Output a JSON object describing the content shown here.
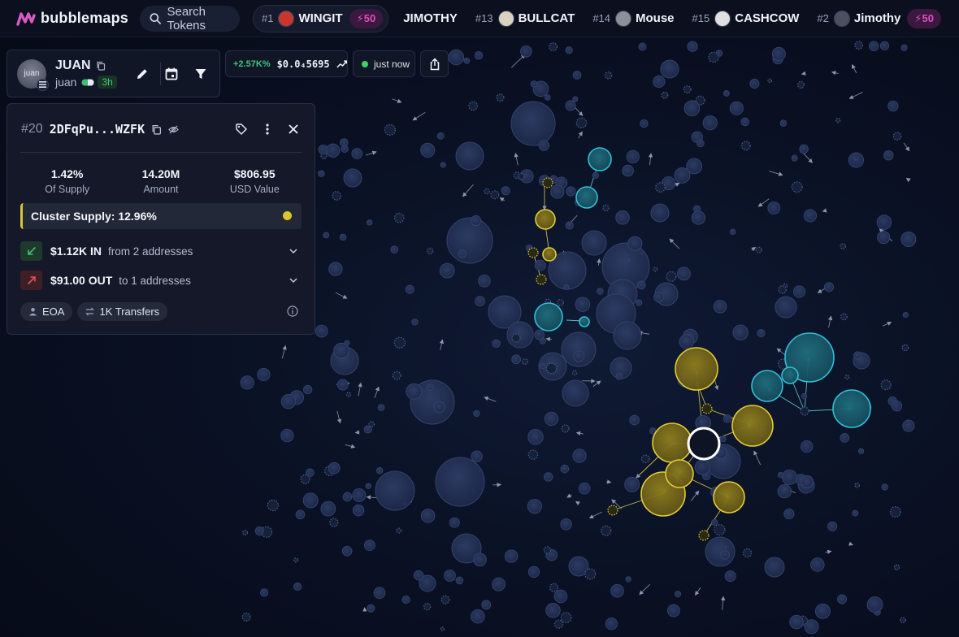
{
  "app": {
    "name": "bubblemaps"
  },
  "search": {
    "placeholder": "Search Tokens"
  },
  "trending": [
    {
      "rank": "#1",
      "name": "WINGIT",
      "boost": "50",
      "avatar_color": "#c8362f"
    },
    {
      "rank": "",
      "name": "JIMOTHY",
      "boost": "",
      "avatar_color": ""
    },
    {
      "rank": "#13",
      "name": "BULLCAT",
      "boost": "",
      "avatar_color": "#d9d2c0"
    },
    {
      "rank": "#14",
      "name": "Mouse",
      "boost": "",
      "avatar_color": "#8a8f9a"
    },
    {
      "rank": "#15",
      "name": "CASHCOW",
      "boost": "",
      "avatar_color": "#e0e0e0"
    },
    {
      "rank": "#2",
      "name": "Jimothy",
      "boost": "50",
      "avatar_color": "#4b5060"
    }
  ],
  "wallet": {
    "name": "JUAN",
    "handle": "juan",
    "age": "3h",
    "avatar_text": "juan"
  },
  "price": {
    "change": "+2.57K%",
    "value": "$0.0₄5695"
  },
  "live": {
    "label": "just now"
  },
  "panel": {
    "rank": "#20",
    "address": "2DFqPu...WZFK",
    "stats": [
      {
        "value": "1.42%",
        "label": "Of Supply"
      },
      {
        "value": "14.20M",
        "label": "Amount"
      },
      {
        "value": "$806.95",
        "label": "USD Value"
      }
    ],
    "cluster_supply": "Cluster Supply: 12.96%",
    "inflow": {
      "amount": "$1.12K IN",
      "desc": "from 2 addresses"
    },
    "outflow": {
      "amount": "$91.00 OUT",
      "desc": "to 1 addresses"
    },
    "tags": {
      "type": "EOA",
      "transfers": "1K Transfers"
    }
  },
  "colors": {
    "accent_pink": "#e04fbd",
    "cluster_yellow": "#dcc52c",
    "cluster_cyan": "#2fb4c8",
    "bubble_default": "#26345a",
    "in_green": "#3fbf78",
    "out_red": "#e2555e"
  }
}
